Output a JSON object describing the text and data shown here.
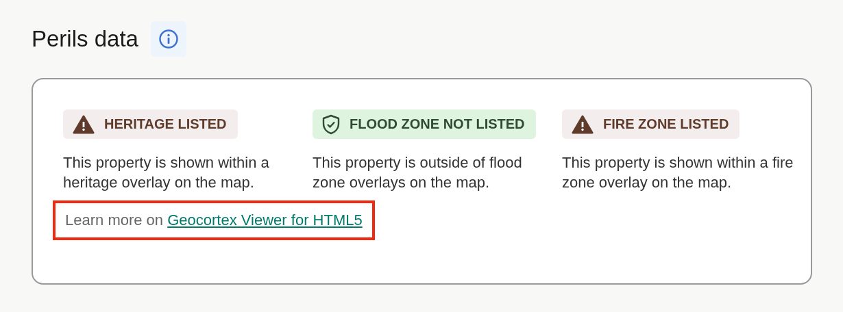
{
  "heading": {
    "title": "Perils data"
  },
  "perils": [
    {
      "kind": "warning",
      "badge": "HERITAGE LISTED",
      "description": "This property is shown within a heritage overlay on the map."
    },
    {
      "kind": "ok",
      "badge": "FLOOD ZONE NOT LISTED",
      "description": "This property is outside of flood zone overlays on the map."
    },
    {
      "kind": "warning",
      "badge": "FIRE ZONE LISTED",
      "description": "This property is shown within a fire zone overlay on the map."
    }
  ],
  "learn_more": {
    "text": "Learn more on",
    "link": "Geocortex Viewer for HTML5",
    "highlighted": true
  }
}
